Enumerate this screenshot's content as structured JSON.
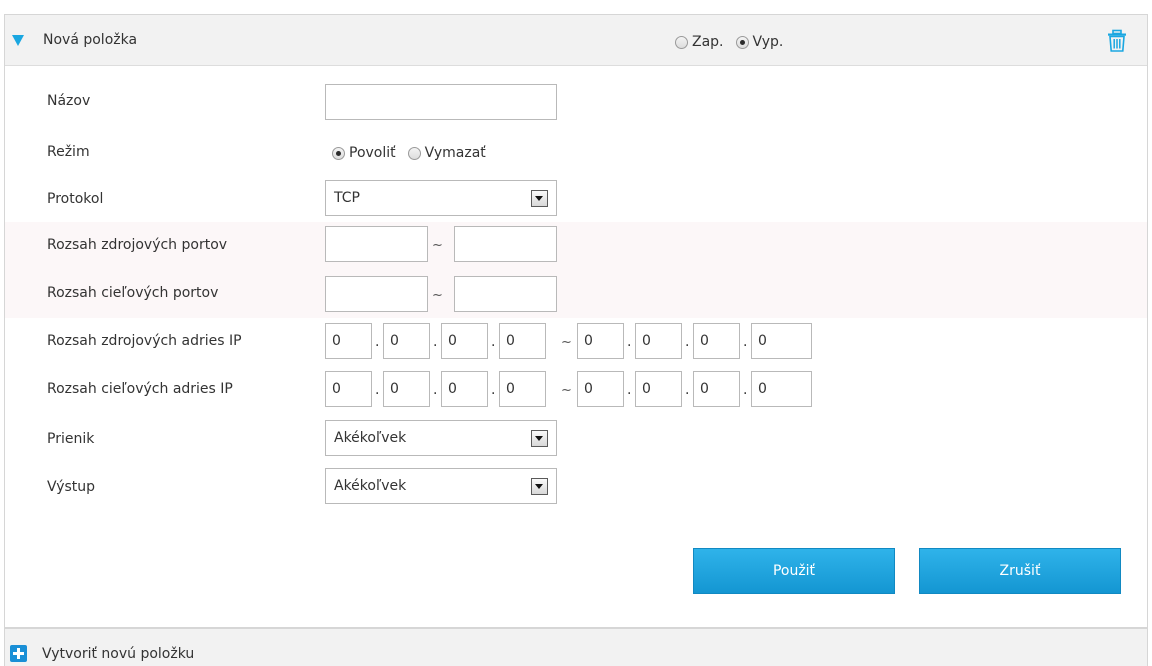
{
  "entry": {
    "title": "Nová položka",
    "status_options": [
      {
        "label": "Zap.",
        "checked": false
      },
      {
        "label": "Vyp.",
        "checked": true
      }
    ],
    "delete_icon": "trash-icon",
    "collapse_icon": "triangle-down-icon"
  },
  "form": {
    "name": {
      "label": "Názov",
      "value": ""
    },
    "mode": {
      "label": "Režim",
      "options": [
        {
          "label": "Povoliť",
          "checked": true
        },
        {
          "label": "Vymazať",
          "checked": false
        }
      ]
    },
    "protocol": {
      "label": "Protokol",
      "value": "TCP"
    },
    "src_ports": {
      "label": "Rozsah zdrojových portov",
      "from": "",
      "to": "",
      "sep": "~"
    },
    "dst_ports": {
      "label": "Rozsah cieľových portov",
      "from": "",
      "to": "",
      "sep": "~"
    },
    "src_ip": {
      "label": "Rozsah zdrojových adries IP",
      "from": [
        "0",
        "0",
        "0",
        "0"
      ],
      "to": [
        "0",
        "0",
        "0",
        "0"
      ],
      "sep": "~"
    },
    "dst_ip": {
      "label": "Rozsah cieľových adries IP",
      "from": [
        "0",
        "0",
        "0",
        "0"
      ],
      "to": [
        "0",
        "0",
        "0",
        "0"
      ],
      "sep": "~"
    },
    "ingress": {
      "label": "Prienik",
      "value": "Akékoľvek"
    },
    "egress": {
      "label": "Výstup",
      "value": "Akékoľvek"
    }
  },
  "actions": {
    "apply": "Použiť",
    "cancel": "Zrušiť"
  },
  "footer": {
    "label": "Vytvoriť novú položku",
    "icon": "plus-icon"
  },
  "colors": {
    "accent": "#1aa7e1",
    "button": "#1ea3dd",
    "header_bg": "#f2f2f2"
  }
}
